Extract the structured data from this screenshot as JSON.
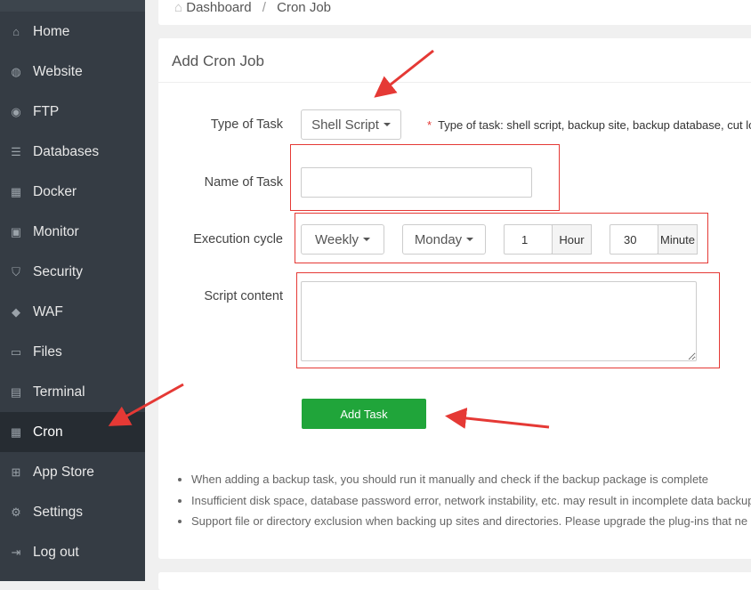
{
  "sidebar": {
    "items": [
      {
        "label": "Home",
        "icon": "home-icon",
        "glyph": "⌂"
      },
      {
        "label": "Website",
        "icon": "globe-icon",
        "glyph": "◍"
      },
      {
        "label": "FTP",
        "icon": "ftp-icon",
        "glyph": "◉"
      },
      {
        "label": "Databases",
        "icon": "database-icon",
        "glyph": "☰"
      },
      {
        "label": "Docker",
        "icon": "docker-icon",
        "glyph": "▦"
      },
      {
        "label": "Monitor",
        "icon": "monitor-icon",
        "glyph": "▣"
      },
      {
        "label": "Security",
        "icon": "shield-icon",
        "glyph": "⛉"
      },
      {
        "label": "WAF",
        "icon": "waf-shield-icon",
        "glyph": "◆"
      },
      {
        "label": "Files",
        "icon": "folder-icon",
        "glyph": "▭"
      },
      {
        "label": "Terminal",
        "icon": "terminal-icon",
        "glyph": "▤"
      },
      {
        "label": "Cron",
        "icon": "calendar-icon",
        "glyph": "▦",
        "active": true
      },
      {
        "label": "App Store",
        "icon": "apps-icon",
        "glyph": "⊞"
      },
      {
        "label": "Settings",
        "icon": "gear-icon",
        "glyph": "⚙"
      },
      {
        "label": "Log out",
        "icon": "logout-icon",
        "glyph": "⇥"
      }
    ]
  },
  "breadcrumb": {
    "home": "Dashboard",
    "separator": "/",
    "current": "Cron Job"
  },
  "form": {
    "title": "Add Cron Job",
    "type_label": "Type of Task",
    "type_value": "Shell Script",
    "type_hint_star": "*",
    "type_hint": "Type of task: shell script, backup site, backup database, cut lo",
    "name_label": "Name of Task",
    "name_value": "",
    "cycle_label": "Execution cycle",
    "cycle_value": "Weekly",
    "day_value": "Monday",
    "hour_value": "1",
    "hour_unit": "Hour",
    "minute_value": "30",
    "minute_unit": "Minute",
    "script_label": "Script content",
    "script_value": "",
    "submit": "Add Task"
  },
  "notes": [
    "When adding a backup task, you should run it manually and check if the backup package is complete",
    "Insufficient disk space, database password error, network instability, etc. may result in incomplete data backup",
    "Support file or directory exclusion when backing up sites and directories. Please upgrade the plug-ins that ne"
  ],
  "colors": {
    "accent": "#20a53a",
    "annotation": "#e53935"
  }
}
